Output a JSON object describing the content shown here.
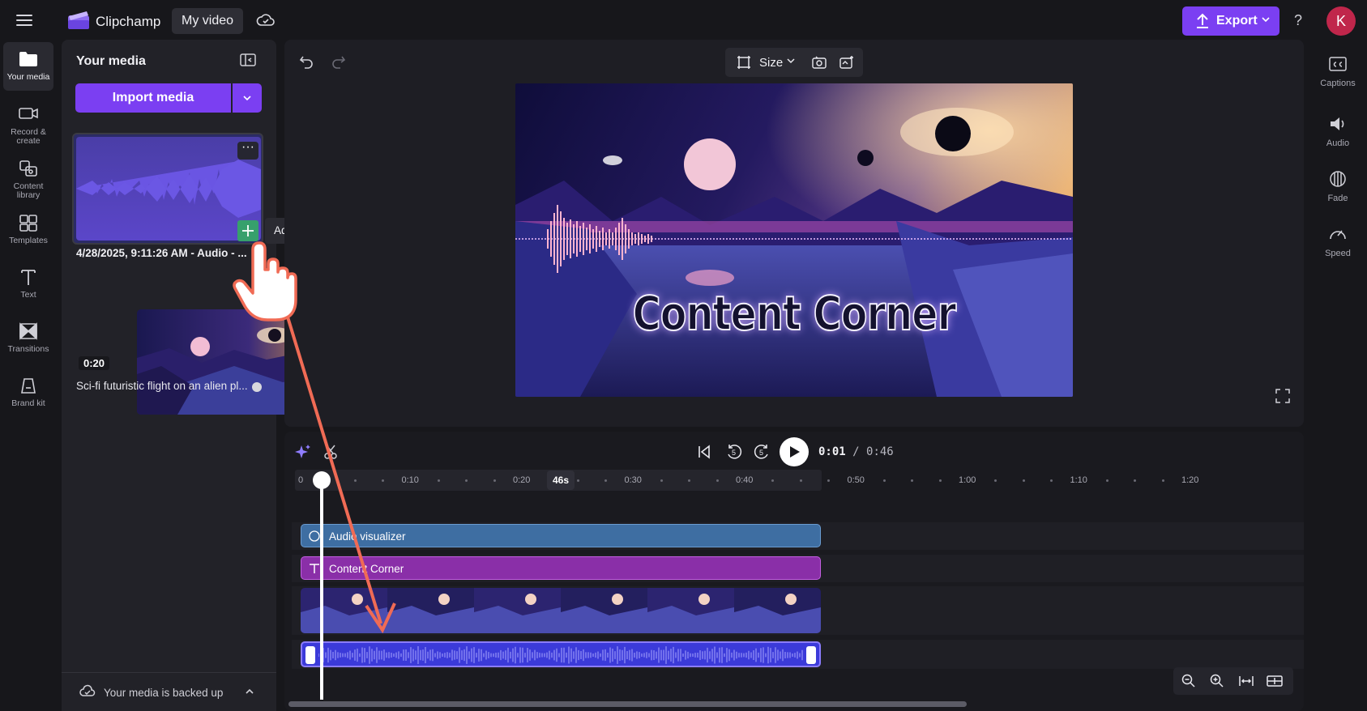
{
  "app": {
    "name": "Clipchamp",
    "project_title": "My video",
    "export_label": "Export",
    "help_label": "?",
    "avatar_initial": "K"
  },
  "nav": [
    {
      "key": "media",
      "label": "Your media",
      "icon": "folder-icon",
      "active": true
    },
    {
      "key": "record",
      "label": "Record &\ncreate",
      "icon": "camera-icon"
    },
    {
      "key": "content",
      "label": "Content\nlibrary",
      "icon": "content-library-icon"
    },
    {
      "key": "templates",
      "label": "Templates",
      "icon": "templates-icon"
    },
    {
      "key": "text",
      "label": "Text",
      "icon": "text-icon"
    },
    {
      "key": "transitions",
      "label": "Transitions",
      "icon": "transitions-icon"
    },
    {
      "key": "brand",
      "label": "Brand kit",
      "icon": "brand-kit-icon"
    }
  ],
  "media": {
    "title": "Your media",
    "import_label": "Import media",
    "items": [
      {
        "caption": "4/28/2025, 9:11:26 AM - Audio - ...",
        "type": "audio"
      },
      {
        "caption": "Sci-fi futuristic flight on an alien pl...",
        "duration": "0:20",
        "type": "video"
      }
    ],
    "tooltip": "Add to timeline",
    "backup_status": "Your media is backed up"
  },
  "preview": {
    "size_label": "Size",
    "video_text": "Content Corner"
  },
  "playback": {
    "current_time": "0:01",
    "total_time": "/ 0:46",
    "rewind_seconds": "5",
    "forward_seconds": "5"
  },
  "timeline": {
    "ruler_labels": [
      "0",
      "0:10",
      "0:20",
      "0:30",
      "0:40",
      "0:50",
      "1:00",
      "1:10",
      "1:20"
    ],
    "length_badge": "46s",
    "playhead_seconds": 1,
    "clips": [
      {
        "label": "Audio visualizer",
        "icon": "visualizer-icon"
      },
      {
        "label": "Content Corner",
        "icon": "text-icon"
      }
    ]
  },
  "right_panel": [
    {
      "label": "Captions",
      "icon": "captions-icon"
    },
    {
      "label": "Audio",
      "icon": "speaker-icon"
    },
    {
      "label": "Fade",
      "icon": "fade-icon"
    },
    {
      "label": "Speed",
      "icon": "speedometer-icon"
    }
  ],
  "colors": {
    "accent": "#7b3ff2",
    "avatar": "#c0264b",
    "audio_clip": "#3b3ad9",
    "text_clip": "#8a2fa8",
    "visualizer_clip": "#3e6ea2",
    "pointer_arrow": "#f06b55"
  }
}
